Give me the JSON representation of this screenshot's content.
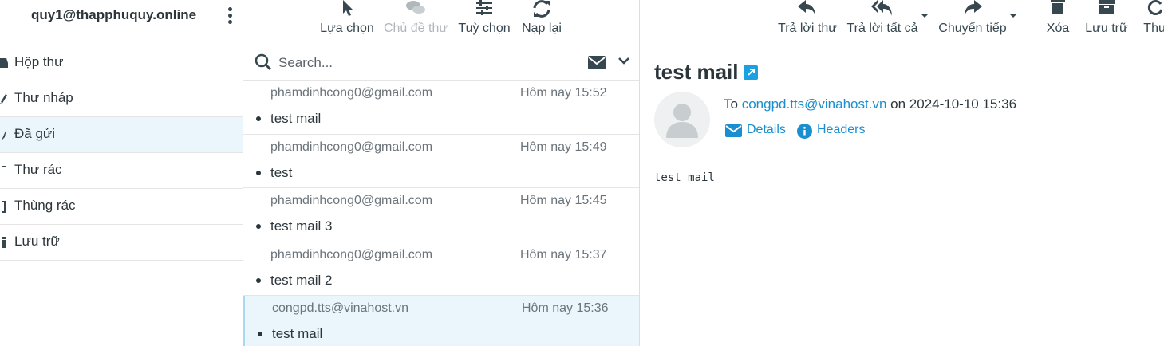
{
  "account": {
    "email": "quy1@thapphuquy.online"
  },
  "folders": [
    {
      "label": "Hộp thư",
      "icon": "inbox-icon"
    },
    {
      "label": "Thư nháp",
      "icon": "pencil-icon"
    },
    {
      "label": "Đã gửi",
      "icon": "paper-plane-icon",
      "active": true
    },
    {
      "label": "Thư rác",
      "icon": "spam-icon"
    },
    {
      "label": "Thùng rác",
      "icon": "trash-icon"
    },
    {
      "label": "Lưu trữ",
      "icon": "archive-icon"
    }
  ],
  "list_toolbar": {
    "select": "Lựa chọn",
    "threads": "Chủ đề thư",
    "options": "Tuỳ chọn",
    "refresh": "Nạp lại"
  },
  "search": {
    "placeholder": "Search..."
  },
  "messages": [
    {
      "from": "phamdinhcong0@gmail.com",
      "date": "Hôm nay 15:52",
      "subject": "test mail"
    },
    {
      "from": "phamdinhcong0@gmail.com",
      "date": "Hôm nay 15:49",
      "subject": "test"
    },
    {
      "from": "phamdinhcong0@gmail.com",
      "date": "Hôm nay 15:45",
      "subject": "test mail 3"
    },
    {
      "from": "phamdinhcong0@gmail.com",
      "date": "Hôm nay 15:37",
      "subject": "test mail 2"
    },
    {
      "from": "congpd.tts@vinahost.vn",
      "date": "Hôm nay 15:36",
      "subject": "test mail",
      "selected": true
    }
  ],
  "preview_toolbar": {
    "reply": "Trả lời thư",
    "reply_all": "Trả lời tất cả",
    "forward": "Chuyển tiếp",
    "delete": "Xóa",
    "archive": "Lưu trữ",
    "more": "Thư"
  },
  "preview": {
    "subject": "test mail",
    "to_prefix": "To",
    "to_address": "congpd.tts@vinahost.vn",
    "on_word": "on",
    "date": "2024-10-10 15:36",
    "details_label": "Details",
    "headers_label": "Headers",
    "body": "test mail"
  },
  "colors": {
    "accent": "#1a8fd0",
    "selected_bg": "#eaf6fc",
    "text": "#2c363a"
  }
}
